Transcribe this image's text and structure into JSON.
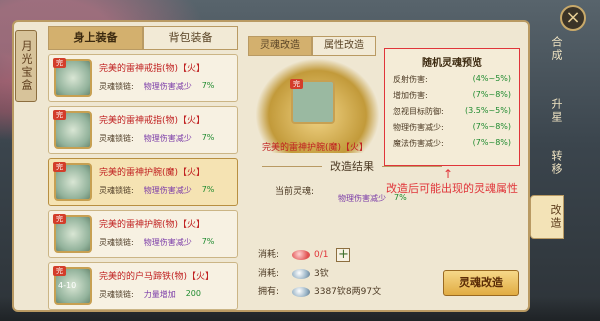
{
  "close_icon": "×",
  "left_tab": "月光宝盒",
  "tabs": [
    {
      "label": "身上装备"
    },
    {
      "label": "背包装备"
    }
  ],
  "items": [
    {
      "name": "完美的雷神戒指(物)【火】",
      "slot": "灵魂锁链:",
      "stat": "物理伤害减少",
      "value": "7%",
      "badge": ""
    },
    {
      "name": "完美的雷神戒指(物)【火】",
      "slot": "灵魂锁链:",
      "stat": "物理伤害减少",
      "value": "7%",
      "badge": ""
    },
    {
      "name": "完美的雷神护腕(魔)【火】",
      "slot": "灵魂锁链:",
      "stat": "物理伤害减少",
      "value": "7%",
      "badge": ""
    },
    {
      "name": "完美的雷神护腕(物)【火】",
      "slot": "灵魂锁链:",
      "stat": "物理伤害减少",
      "value": "7%",
      "badge": ""
    },
    {
      "name": "完美的的户马蹄铁(物)【火】",
      "slot": "灵魂锁链:",
      "stat": "力量增加",
      "value": "200",
      "badge": "4-10"
    }
  ],
  "center_tabs": [
    {
      "label": "灵魂改造"
    },
    {
      "label": "属性改造"
    }
  ],
  "selected_name": "完美的雷神护腕(魔)【火】",
  "result_title": "改造结果",
  "current_label": "当前灵魂:",
  "current_stat": {
    "stat": "物理伤害减少",
    "value": "7%"
  },
  "preview": {
    "title": "随机灵魂预览",
    "rows": [
      {
        "label": "反射伤害:",
        "value": "(4%~5%)"
      },
      {
        "label": "增加伤害:",
        "value": "(7%~8%)"
      },
      {
        "label": "忽视目标防御:",
        "value": "(3.5%~5%)"
      },
      {
        "label": "物理伤害减少:",
        "value": "(7%~8%)"
      },
      {
        "label": "魔法伤害减少:",
        "value": "(7%~8%)"
      }
    ]
  },
  "annotation": "改造后可能出现的灵魂属性",
  "consumption": [
    {
      "label": "消耗:",
      "value": "0/1",
      "value_red": true,
      "has_plus": true
    },
    {
      "label": "消耗:",
      "value": "3钦",
      "value_red": false,
      "has_plus": false
    },
    {
      "label": "拥有:",
      "value": "3387钦8两97文",
      "value_red": false,
      "has_plus": false
    }
  ],
  "action_label": "灵魂改造",
  "rail": [
    {
      "label": "合成"
    },
    {
      "label": "升星"
    },
    {
      "label": "转移"
    },
    {
      "label": "改造"
    }
  ]
}
